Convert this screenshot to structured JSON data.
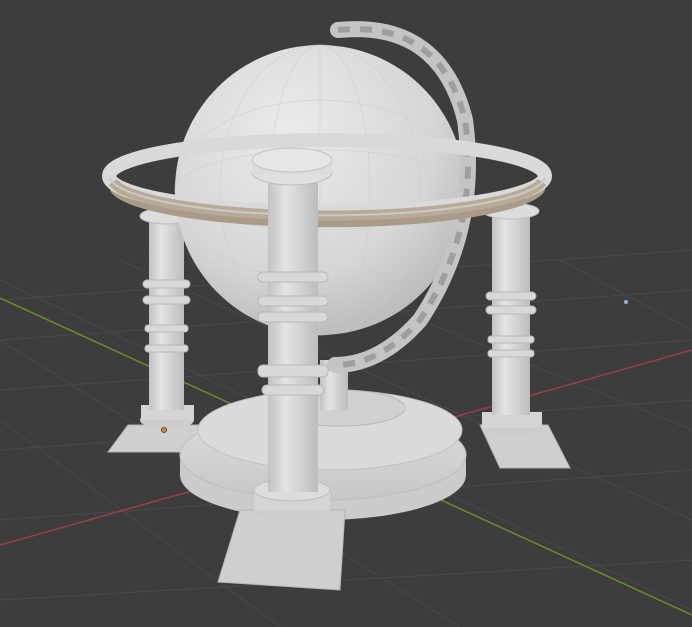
{
  "viewport": {
    "background": "#3d3d3d",
    "grid_color": "#4a4a4a",
    "x_axis_color": "#a0444c",
    "y_axis_color": "#6c8f2a",
    "object_color": "#d9d9d9",
    "object_shadow": "#b8b8b8",
    "ring_underside_color": "#a89c88",
    "origin_point_color": "#e58a1c",
    "light_gizmo_color": "#8ab6e0"
  },
  "scene": {
    "object": "globe-gazebo-model",
    "pillar_count": 4
  }
}
